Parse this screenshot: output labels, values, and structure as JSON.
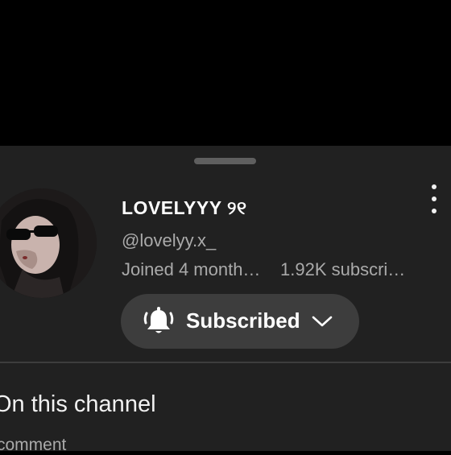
{
  "channel": {
    "name": "LOVELYYY ୨୧",
    "handle": "@lovelyy.x_",
    "joined": "Joined 4 month…",
    "subscribers": "1.92K subscri…"
  },
  "subscribe_button": {
    "label": "Subscribed",
    "icon": "bell-icon",
    "dropdown_icon": "chevron-down-icon"
  },
  "more_menu": {
    "icon": "more-vert-icon"
  },
  "section": {
    "title": "On this channel",
    "subtitle": "comment"
  },
  "colors": {
    "background": "#000000",
    "sheet": "#212121",
    "button": "#3d3d3d",
    "primary_text": "#ffffff",
    "secondary_text": "#aaaaaa"
  }
}
